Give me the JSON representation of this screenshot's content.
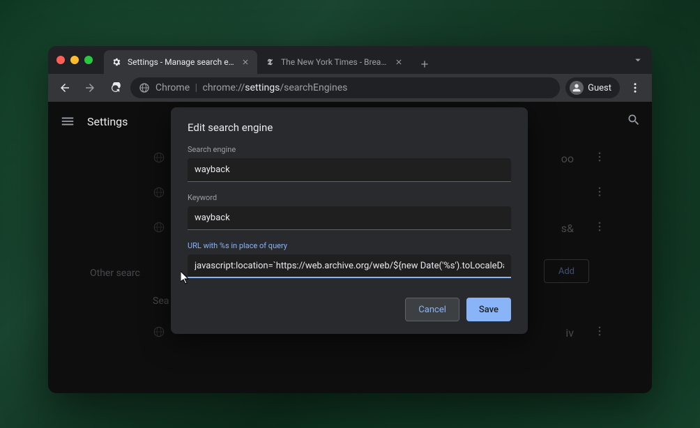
{
  "tabs": [
    {
      "title": "Settings - Manage search engi",
      "favicon": "gear-icon",
      "active": true
    },
    {
      "title": "The New York Times - Breaking",
      "favicon": "nyt-icon",
      "active": false
    }
  ],
  "toolbar": {
    "url_scheme": "Chrome",
    "url_path_prefix": "chrome://",
    "url_path_bold": "settings",
    "url_path_suffix": "/searchEngines",
    "profile_label": "Guest"
  },
  "settings": {
    "title": "Settings",
    "bg_rows": [
      {
        "text": "oo"
      },
      {
        "text": ""
      },
      {
        "text": "s&"
      }
    ],
    "other_label": "Other searc",
    "search_label": "Sea",
    "add_label": "Add",
    "bg_row4": {
      "text": "iv"
    }
  },
  "dialog": {
    "title": "Edit search engine",
    "name_label": "Search engine",
    "name_value": "wayback",
    "keyword_label": "Keyword",
    "keyword_value": "wayback",
    "url_label": "URL with %s in place of query",
    "url_value": "javascript:location=`https://web.archive.org/web/${new Date('%s').toLocaleDate",
    "cancel_label": "Cancel",
    "save_label": "Save"
  }
}
